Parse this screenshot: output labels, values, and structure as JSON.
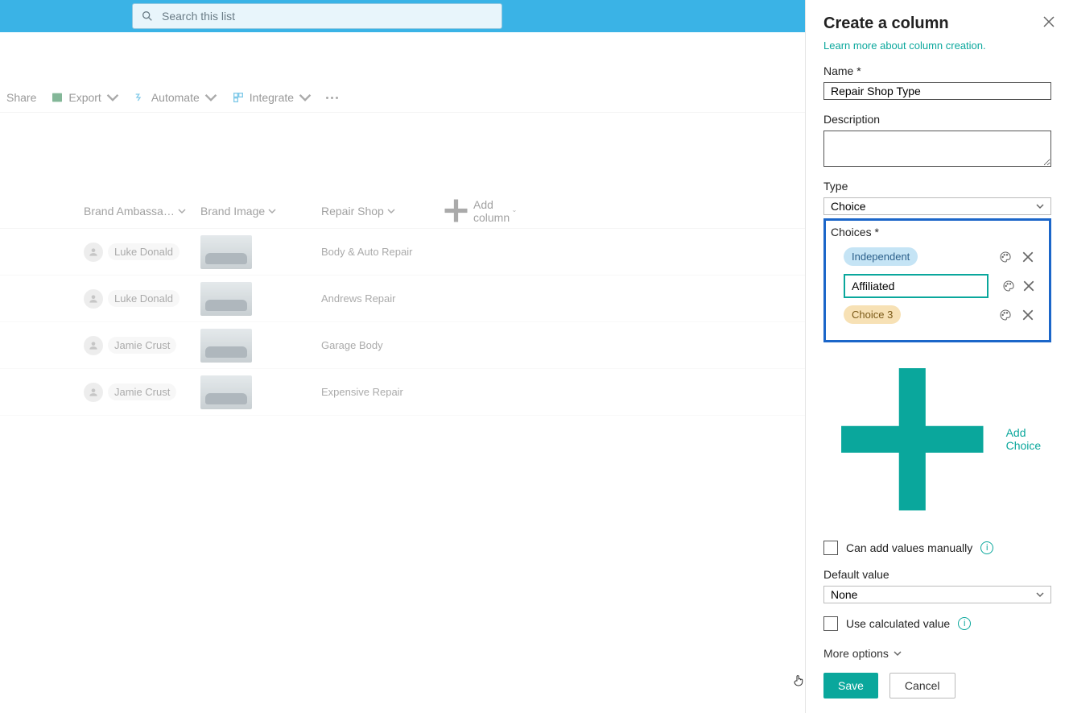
{
  "search": {
    "placeholder": "Search this list"
  },
  "toolbar": {
    "share": "Share",
    "export": "Export",
    "automate": "Automate",
    "integrate": "Integrate"
  },
  "columns": {
    "brand_ambassador": "Brand Ambassa…",
    "brand_image": "Brand Image",
    "repair_shop": "Repair Shop",
    "add_column": "Add column"
  },
  "rows": [
    {
      "ambassador": "Luke Donald",
      "repair_shop": "Body & Auto Repair"
    },
    {
      "ambassador": "Luke Donald",
      "repair_shop": "Andrews Repair"
    },
    {
      "ambassador": "Jamie Crust",
      "repair_shop": "Garage Body"
    },
    {
      "ambassador": "Jamie Crust",
      "repair_shop": "Expensive Repair"
    }
  ],
  "panel": {
    "title": "Create a column",
    "learn_link": "Learn more about column creation.",
    "name_label": "Name",
    "name_value": "Repair Shop Type",
    "description_label": "Description",
    "description_value": "",
    "type_label": "Type",
    "type_value": "Choice",
    "choices_label": "Choices",
    "choices": [
      {
        "kind": "pill",
        "label": "Independent",
        "color": "blue"
      },
      {
        "kind": "input",
        "value": "Affiliated"
      },
      {
        "kind": "pill",
        "label": "Choice 3",
        "color": "amber"
      }
    ],
    "add_choice": "Add Choice",
    "can_add_manually": "Can add values manually",
    "default_value_label": "Default value",
    "default_value": "None",
    "use_calculated": "Use calculated value",
    "more_options": "More options",
    "save": "Save",
    "cancel": "Cancel"
  }
}
